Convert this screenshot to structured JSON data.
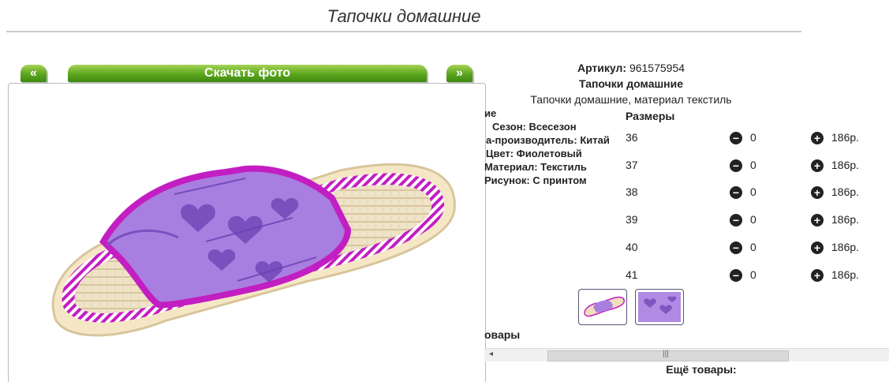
{
  "page": {
    "title": "Тапочки домашние"
  },
  "gallery": {
    "prev_label": "«",
    "download_label": "Скачать фото",
    "next_label": "»"
  },
  "product": {
    "article_label": "Артикул:",
    "article_value": "961575954",
    "name": "Тапочки домашние",
    "description": "Тапочки домашние, материал текстиль"
  },
  "features": {
    "header": "ие",
    "items": [
      "Сезон: Всесезон",
      "а-производитель: Китай",
      "Цвет: Фиолетовый",
      "Материал: Текстиль",
      "Рисунок: С принтом"
    ]
  },
  "sizes": {
    "header": "Размеры",
    "rows": [
      {
        "size": "36",
        "qty": "0",
        "price": "186р."
      },
      {
        "size": "37",
        "qty": "0",
        "price": "186р."
      },
      {
        "size": "38",
        "qty": "0",
        "price": "186р."
      },
      {
        "size": "39",
        "qty": "0",
        "price": "186р."
      },
      {
        "size": "40",
        "qty": "0",
        "price": "186р."
      },
      {
        "size": "41",
        "qty": "0",
        "price": "186р."
      }
    ],
    "minus_symbol": "−",
    "plus_symbol": "+"
  },
  "related": {
    "title_partial": "овары",
    "more_title": "Ещё товары:"
  },
  "colors": {
    "accent_green": "#5aa51d",
    "slipper_purple": "#a87fe0",
    "stripe_magenta": "#c21ec2"
  }
}
